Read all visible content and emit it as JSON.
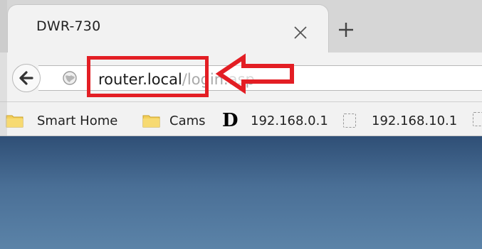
{
  "tab": {
    "title": "DWR-730"
  },
  "address_bar": {
    "host": "router.local",
    "path": "/login.asp"
  },
  "bookmarks": [
    {
      "label": "Smart Home",
      "icon": "folder-icon"
    },
    {
      "label": "Cams",
      "icon": "folder-icon"
    },
    {
      "label": "192.168.0.1",
      "icon": "dlink-icon"
    },
    {
      "label": "192.168.10.1",
      "icon": "page-icon"
    }
  ],
  "colors": {
    "annotation_red": "#e31e24",
    "folder_yellow": "#f3cf5a",
    "content_blue": "#3f628a"
  }
}
